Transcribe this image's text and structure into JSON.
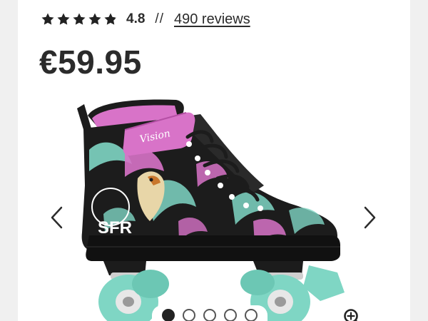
{
  "rating": {
    "stars_filled": 4.8,
    "stars_total": 5,
    "value": "4.8",
    "separator": "//",
    "reviews_link": "490 reviews"
  },
  "price": "€59.95",
  "gallery": {
    "slide_count": 5,
    "active_slide": 1,
    "prev_icon": "chevron-left-icon",
    "next_icon": "chevron-right-icon",
    "zoom_icon": "zoom-in-icon",
    "logo_text": "SFR",
    "strap_text": "Vision"
  },
  "colors": {
    "text": "#2b2b2b",
    "card": "#ffffff",
    "background": "#f0f0f0",
    "skate_pink": "#d873c8",
    "wheel_mint": "#7fd6c4",
    "boot_black": "#1c1c1c"
  }
}
